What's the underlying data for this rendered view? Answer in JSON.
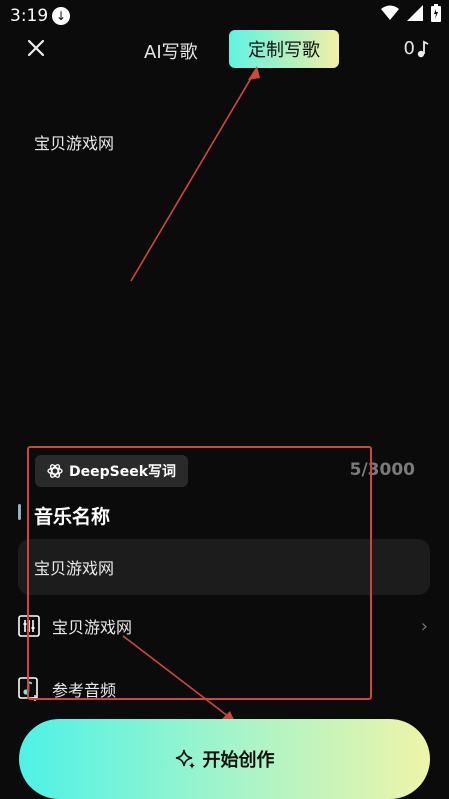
{
  "status": {
    "time": "3:19"
  },
  "header": {
    "tab_ai": "AI写歌",
    "tab_custom": "定制写歌",
    "credits": "0"
  },
  "prompt": {
    "text": "宝贝游戏网"
  },
  "composer": {
    "deepseek_label": "DeepSeek写词",
    "char_count": "5/3000",
    "music_name_label": "音乐名称",
    "music_name_value": "宝贝游戏网",
    "style_value": "宝贝游戏网",
    "reference_audio_label": "参考音频"
  },
  "start_button": {
    "label": "开始创作"
  },
  "colors": {
    "accent_start": "#4ef2e6",
    "accent_end": "#eef4a8",
    "annotation": "#d2453a",
    "background": "#0b0b0b"
  }
}
